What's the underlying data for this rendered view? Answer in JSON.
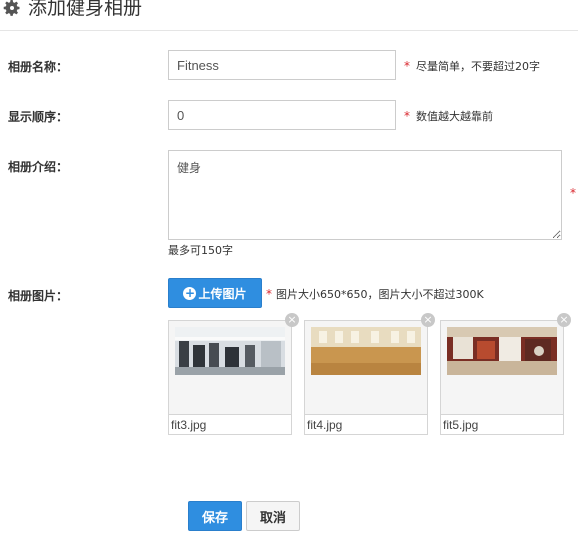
{
  "header": {
    "title": "添加健身相册",
    "icon": "gear-icon"
  },
  "form": {
    "name": {
      "label": "相册名称：",
      "value": "Fitness",
      "required_mark": "*",
      "hint": "尽量简单，不要超过20字"
    },
    "order": {
      "label": "显示顺序：",
      "value": "0",
      "required_mark": "*",
      "hint": "数值越大越靠前"
    },
    "intro": {
      "label": "相册介绍：",
      "value": "健身",
      "required_mark": "*",
      "limit_note": "最多可150字"
    },
    "images": {
      "label": "相册图片：",
      "upload_label": "上传图片",
      "required_mark": "*",
      "hint": "图片大小650*650，图片大小不超过300K",
      "items": [
        {
          "filename": "fit3.jpg"
        },
        {
          "filename": "fit4.jpg"
        },
        {
          "filename": "fit5.jpg"
        }
      ]
    }
  },
  "actions": {
    "save_label": "保存",
    "cancel_label": "取消"
  },
  "colors": {
    "primary": "#2f8ee0",
    "required": "#d9272e"
  }
}
